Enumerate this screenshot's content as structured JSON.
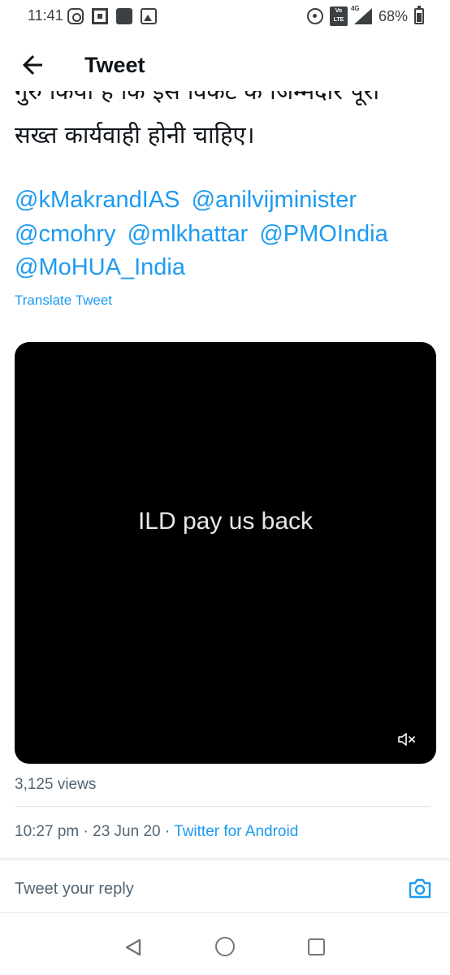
{
  "status_bar": {
    "time": "11:41",
    "left_icons": [
      "instagram-icon",
      "qr-icon",
      "news-icon",
      "gallery-icon"
    ],
    "right_icons": [
      "hotspot-icon",
      "volte-icon",
      "signal-icon",
      "battery-icon"
    ],
    "volte_label": "Vo\nLTE",
    "network": "4G",
    "battery": "68%"
  },
  "header": {
    "back_icon": "arrow-left-icon",
    "title": "Tweet"
  },
  "tweet": {
    "text_line_clipped": "गुरु किया है कि इस विकट के जिम्मेदार पूरा",
    "text_line": "सख्त कार्यवाही होनी चाहिए।",
    "mentions": [
      "@kMakrandIAS",
      "@anilvijminister",
      "@cmohry",
      "@mlkhattar",
      "@PMOIndia",
      "@MoHUA_India"
    ],
    "translate_label": "Translate Tweet",
    "media": {
      "caption": "ILD pay us back",
      "mute_icon": "volume-mute-icon"
    },
    "views": "3,125 views",
    "time": "10:27 pm",
    "sep": "·",
    "date": "23 Jun 20",
    "source": "Twitter for Android"
  },
  "reply": {
    "placeholder": "Tweet your reply",
    "camera_icon": "camera-icon"
  },
  "nav": {
    "icons": [
      "nav-back-icon",
      "nav-home-icon",
      "nav-recents-icon"
    ]
  },
  "colors": {
    "accent": "#1d9bf0",
    "secondary_text": "#536471",
    "text": "#0f1419",
    "media_bg": "#000000"
  }
}
